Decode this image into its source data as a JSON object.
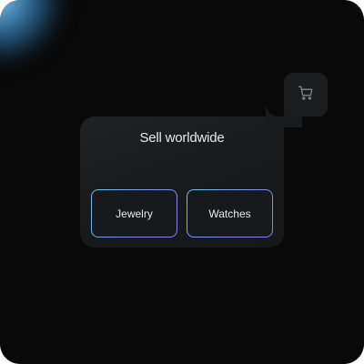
{
  "card": {
    "title": "Sell worldwide",
    "chips": [
      {
        "label": "Jewelry"
      },
      {
        "label": "Watches"
      }
    ]
  },
  "cart": {
    "icon": "shopping-cart-icon"
  },
  "colors": {
    "background": "#090909",
    "card": "#1b1e21",
    "accent_start": "#6fc3e8",
    "accent_end": "#9a78f2",
    "glow": "#78c8ff"
  }
}
